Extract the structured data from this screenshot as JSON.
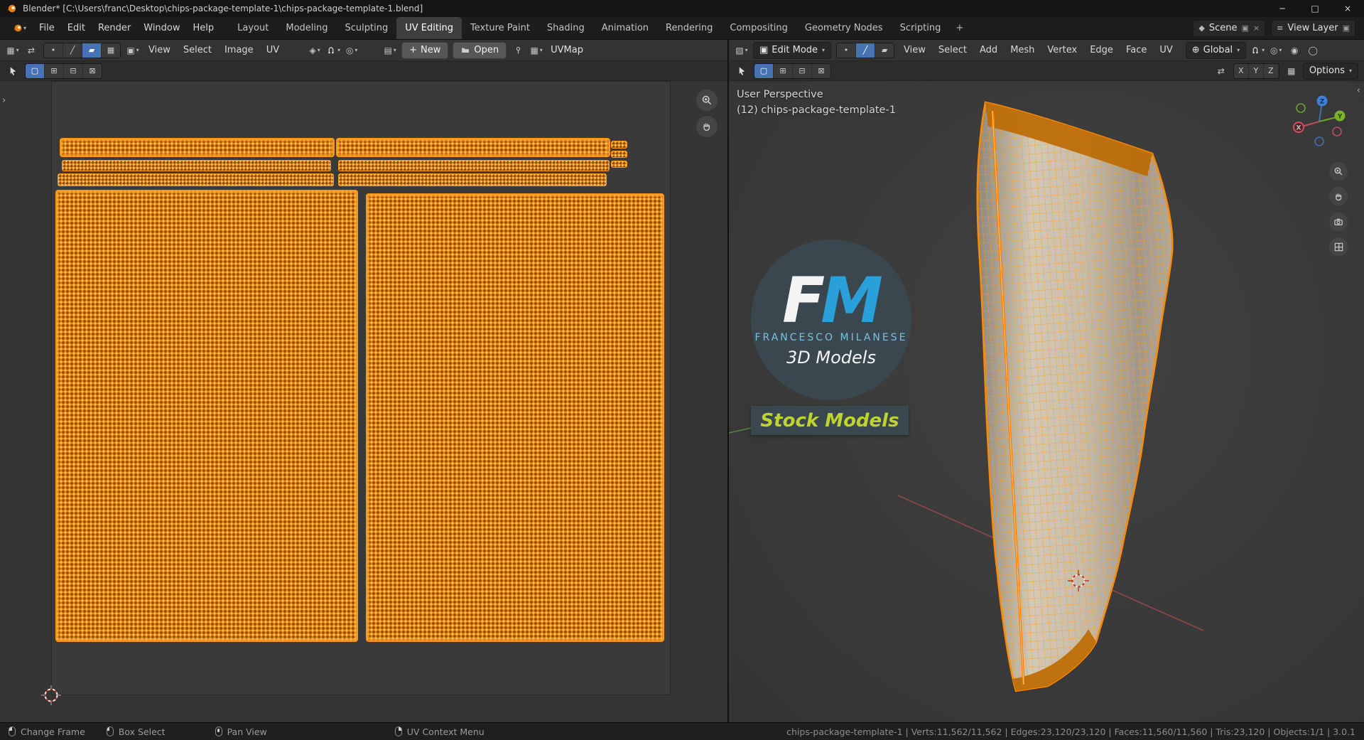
{
  "window": {
    "title": "Blender* [C:\\Users\\franc\\Desktop\\chips-package-template-1\\chips-package-template-1.blend]"
  },
  "topbar": {
    "menus": [
      "File",
      "Edit",
      "Render",
      "Window",
      "Help"
    ],
    "workspaces": [
      "Layout",
      "Modeling",
      "Sculpting",
      "UV Editing",
      "Texture Paint",
      "Shading",
      "Animation",
      "Rendering",
      "Compositing",
      "Geometry Nodes",
      "Scripting"
    ],
    "active_workspace": "UV Editing",
    "add_tab": "+",
    "scene": "Scene",
    "view_layer": "View Layer"
  },
  "uv_editor": {
    "menus": [
      "View",
      "Select",
      "Image",
      "UV"
    ],
    "new_button": "New",
    "open_button": "Open",
    "uv_map": "UVMap"
  },
  "viewport": {
    "mode": "Edit Mode",
    "menus": [
      "View",
      "Select",
      "Add",
      "Mesh",
      "Vertex",
      "Edge",
      "Face",
      "UV"
    ],
    "orientation": "Global",
    "axis_buttons": [
      "X",
      "Y",
      "Z"
    ],
    "options": "Options",
    "overlay_line1": "User Perspective",
    "overlay_line2": "(12) chips-package-template-1",
    "gizmo_axes": [
      "X",
      "Y",
      "Z"
    ]
  },
  "watermark": {
    "f": "F",
    "m": "M",
    "name": "FRANCESCO MILANESE",
    "line2": "3D Models",
    "badge": "Stock Models"
  },
  "status_bar": {
    "hints": [
      "Change Frame",
      "Box Select",
      "Pan View",
      "UV Context Menu"
    ],
    "stats": "chips-package-template-1 | Verts:11,562/11,562 | Edges:23,120/23,120 | Faces:11,560/11,560 | Tris:23,120 | Objects:1/1 | 3.0.1"
  },
  "colors": {
    "uv_orange": "#ee8803",
    "selection_blue": "#4772b3",
    "logo_blue": "#2aa6e4",
    "badge_green": "#c7db2f"
  },
  "glyphs": {
    "caret": "▾",
    "uv_editor": "▦",
    "viewport_3d": "▧",
    "sync": "⇄",
    "vertex": "•",
    "edge": "╱",
    "face": "▰",
    "island": "▦",
    "sticky": "▣",
    "pivot": "◈",
    "prop_edit": "◎",
    "browse_image": "▤",
    "edit_cube": "▣",
    "orientation": "⊕",
    "scene": "◆",
    "view_layer": "≡",
    "dup": "▣",
    "close": "×",
    "box": "▢",
    "extend": "⊞",
    "subtract": "⊟",
    "intersect": "⊠",
    "chev_left": "‹",
    "chev_right": "›",
    "mirror": "⇄",
    "snap_grid": "▦",
    "overlay_a": "◉",
    "overlay_b": "◯",
    "minimize": "─",
    "maximize": "□",
    "plus": "+"
  }
}
